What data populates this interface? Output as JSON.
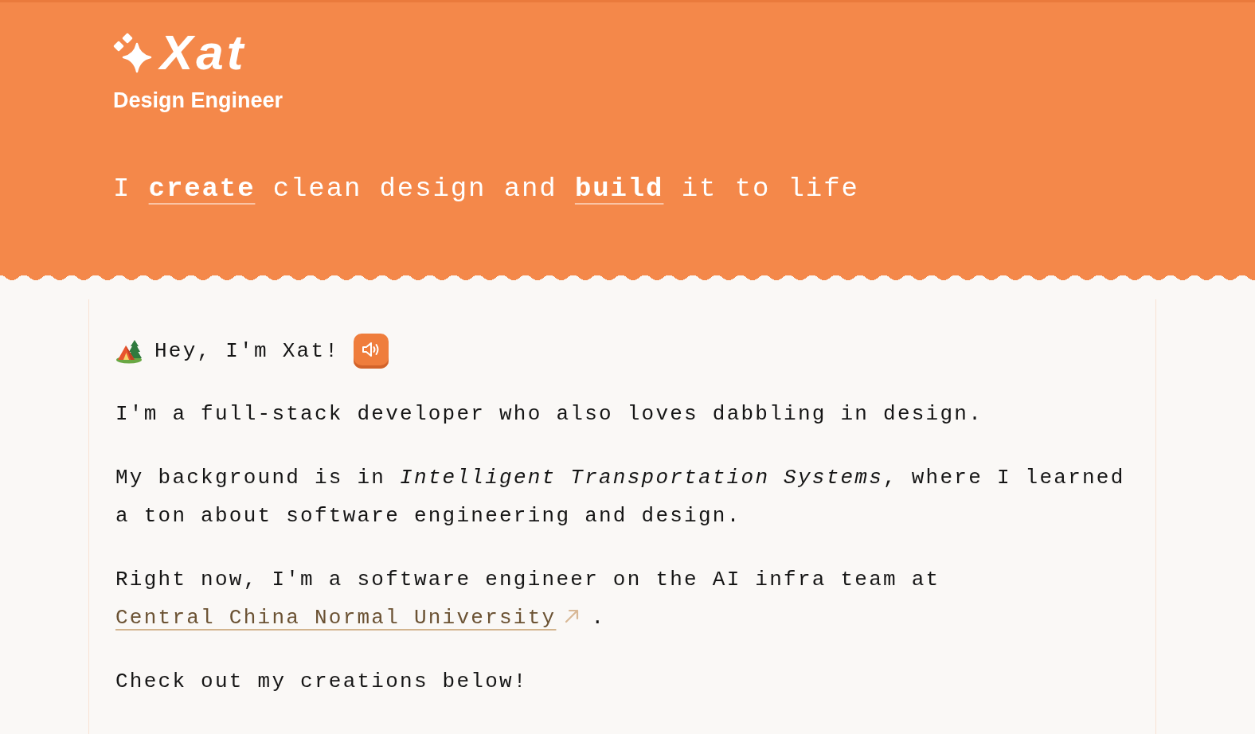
{
  "header": {
    "logo": "Xat",
    "subtitle": "Design Engineer",
    "tagline": "I **create** clean design and **build** it to life"
  },
  "intro": {
    "greeting": "Hey, I'm Xat!"
  },
  "paragraphs": [
    {
      "kind": "text",
      "text": "I'm a full-stack developer who also loves dabbling in design."
    },
    {
      "kind": "text",
      "text": "My background is in *Intelligent Transportation Systems*, where I learned a ton about software engineering and design."
    },
    {
      "kind": "link",
      "text": "Right now, I'm a software engineer on the AI infra team at",
      "link": "Central China Normal University",
      "after": "."
    },
    {
      "kind": "text",
      "text": "Check out my creations below!"
    }
  ]
}
